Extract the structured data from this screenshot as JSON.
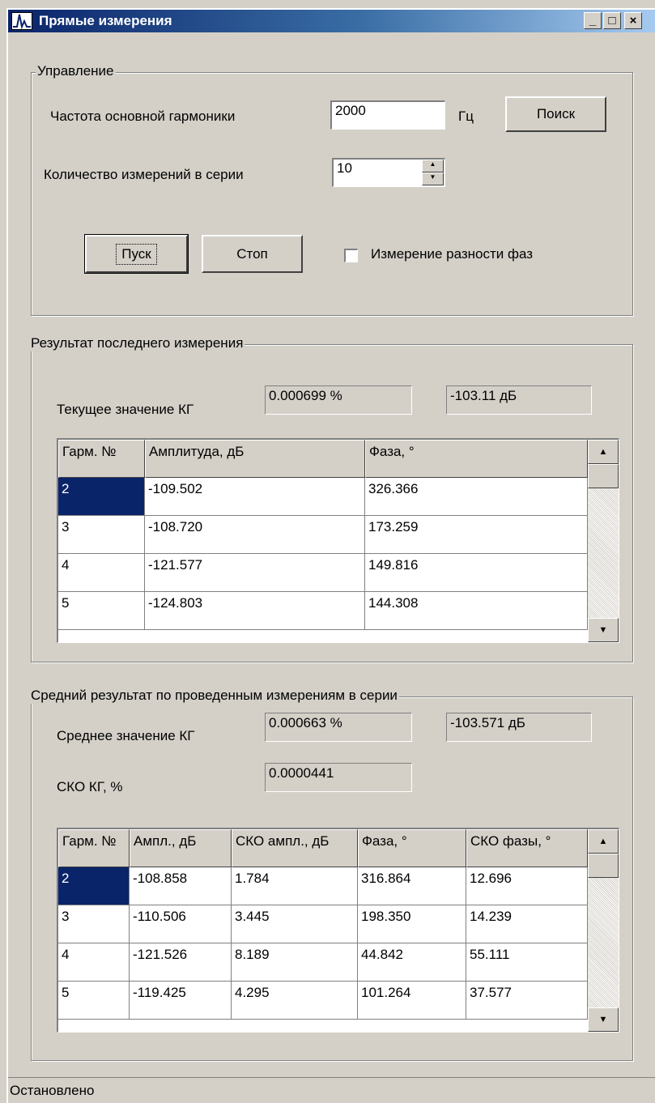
{
  "window": {
    "title": "Прямые измерения",
    "minimize_glyph": "_",
    "maximize_glyph": "□",
    "close_glyph": "×"
  },
  "control": {
    "legend": "Управление",
    "freq_label": "Частота основной гармоники",
    "freq_value": "2000",
    "freq_unit": "Гц",
    "search_button": "Поиск",
    "count_label": "Количество измерений в серии",
    "count_value": "10",
    "start_button": "Пуск",
    "stop_button": "Стоп",
    "phase_checkbox_label": "Измерение разности фаз",
    "phase_checked": false
  },
  "last": {
    "legend": "Результат последнего измерения",
    "thd_label": "Текущее значение КГ",
    "thd_percent": "0.000699 %",
    "thd_db": "-103.11 дБ",
    "table": {
      "headers": [
        "Гарм. №",
        "Амплитуда, дБ",
        "Фаза, °"
      ],
      "rows": [
        [
          "2",
          "-109.502",
          "326.366"
        ],
        [
          "3",
          "-108.720",
          "173.259"
        ],
        [
          "4",
          "-121.577",
          "149.816"
        ],
        [
          "5",
          "-124.803",
          "144.308"
        ]
      ]
    }
  },
  "avg": {
    "legend": "Средний результат по проведенным измерениям в серии",
    "thd_label": "Среднее значение КГ",
    "thd_percent": "0.000663 %",
    "thd_db": "-103.571 дБ",
    "sko_label": "СКО КГ, %",
    "sko_value": "0.0000441",
    "table": {
      "headers": [
        "Гарм. №",
        "Ампл., дБ",
        "СКО ампл., дБ",
        "Фаза, °",
        "СКО фазы, °"
      ],
      "rows": [
        [
          "2",
          "-108.858",
          "1.784",
          "316.864",
          "12.696"
        ],
        [
          "3",
          "-110.506",
          "3.445",
          "198.350",
          "14.239"
        ],
        [
          "4",
          "-121.526",
          "8.189",
          "44.842",
          "55.111"
        ],
        [
          "5",
          "-119.425",
          "4.295",
          "101.264",
          "37.577"
        ]
      ]
    }
  },
  "status": {
    "text": "Остановлено"
  },
  "colors": {
    "face": "#d4d0c8",
    "selection": "#0a246a",
    "title_start": "#0a246a"
  }
}
